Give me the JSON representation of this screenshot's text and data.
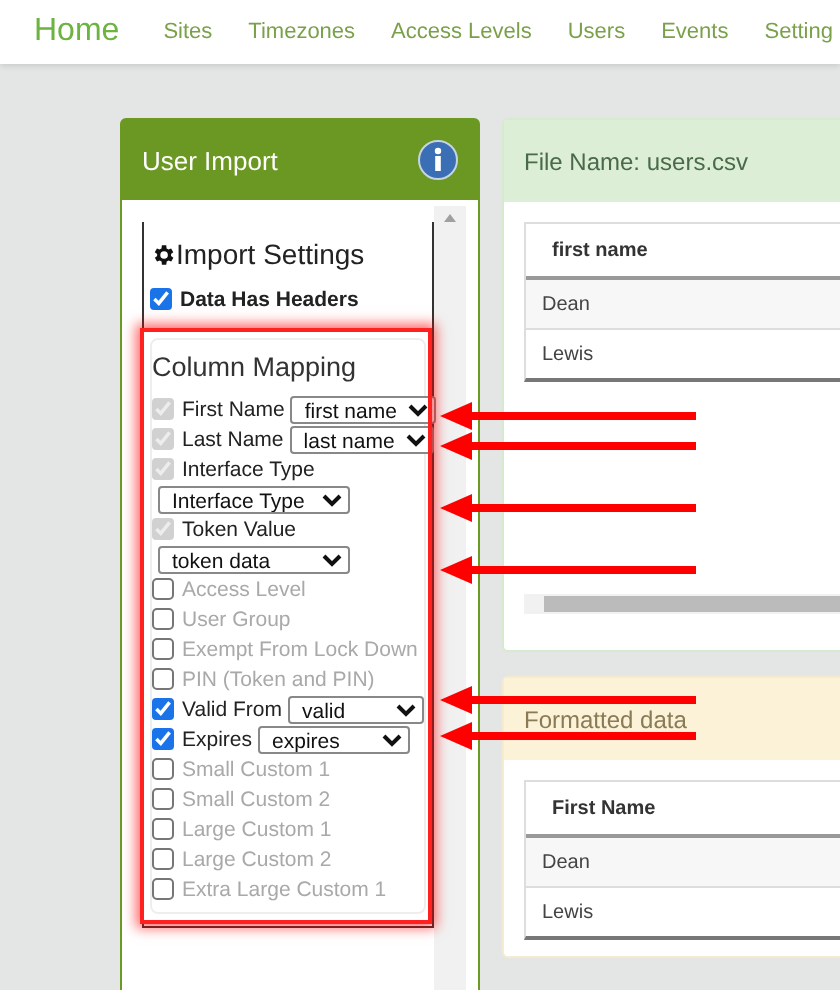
{
  "nav": {
    "home": "Home",
    "links": [
      "Sites",
      "Timezones",
      "Access Levels",
      "Users",
      "Events",
      "Setting"
    ]
  },
  "import_panel": {
    "title": "User Import",
    "settings_title": "Import Settings",
    "has_headers": {
      "label": "Data Has Headers",
      "checked": true
    },
    "mapping_title": "Column Mapping",
    "fields": [
      {
        "label": "First Name",
        "checked": true,
        "disabled": true,
        "kind": "inline",
        "value": "first name"
      },
      {
        "label": "Last Name",
        "checked": true,
        "disabled": true,
        "kind": "inline",
        "value": "last name"
      },
      {
        "label": "Interface Type",
        "checked": true,
        "disabled": true,
        "kind": "below",
        "value": "Interface Type"
      },
      {
        "label": "Token Value",
        "checked": true,
        "disabled": true,
        "kind": "below",
        "value": "token data"
      },
      {
        "label": "Access Level",
        "checked": false,
        "disabled": false,
        "kind": "plain"
      },
      {
        "label": "User Group",
        "checked": false,
        "disabled": false,
        "kind": "plain"
      },
      {
        "label": "Exempt From Lock Down",
        "checked": false,
        "disabled": false,
        "kind": "plain"
      },
      {
        "label": "PIN (Token and PIN)",
        "checked": false,
        "disabled": false,
        "kind": "plain"
      },
      {
        "label": "Valid From",
        "checked": true,
        "disabled": false,
        "kind": "inline",
        "value": "valid"
      },
      {
        "label": "Expires",
        "checked": true,
        "disabled": false,
        "kind": "inline",
        "value": "expires"
      },
      {
        "label": "Small Custom 1",
        "checked": false,
        "disabled": false,
        "kind": "plain"
      },
      {
        "label": "Small Custom 2",
        "checked": false,
        "disabled": false,
        "kind": "plain"
      },
      {
        "label": "Large Custom 1",
        "checked": false,
        "disabled": false,
        "kind": "plain"
      },
      {
        "label": "Large Custom 2",
        "checked": false,
        "disabled": false,
        "kind": "plain"
      },
      {
        "label": "Extra Large Custom 1",
        "checked": false,
        "disabled": false,
        "kind": "plain"
      }
    ]
  },
  "file_panel": {
    "title": "File Name: users.csv",
    "columns": [
      "first name"
    ],
    "rows": [
      [
        "Dean"
      ],
      [
        "Lewis"
      ]
    ]
  },
  "formatted_panel": {
    "title": "Formatted data",
    "columns": [
      "First Name"
    ],
    "rows": [
      [
        "Dean"
      ],
      [
        "Lewis"
      ]
    ]
  }
}
